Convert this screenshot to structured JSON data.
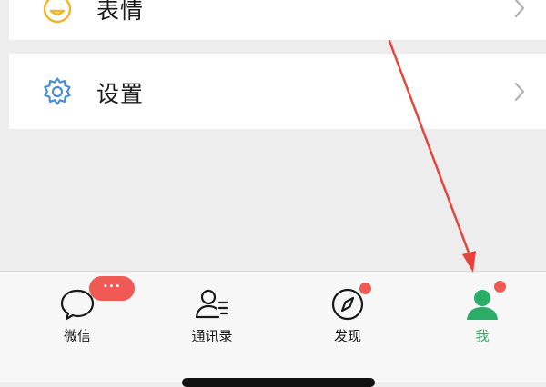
{
  "menu": {
    "items": [
      {
        "label": "表情",
        "icon": "emoji-icon"
      },
      {
        "label": "设置",
        "icon": "gear-icon"
      }
    ]
  },
  "tabbar": {
    "tabs": [
      {
        "label": "微信",
        "icon": "chat-bubble-icon",
        "badge": "···"
      },
      {
        "label": "通讯录",
        "icon": "contacts-icon"
      },
      {
        "label": "发现",
        "icon": "compass-icon",
        "badge_dot": true
      },
      {
        "label": "我",
        "icon": "person-icon",
        "badge_dot": true,
        "active": true
      }
    ]
  },
  "colors": {
    "accent_green": "#2aae67",
    "badge_red": "#f05a55",
    "icon_blue": "#4a8fd6",
    "annotation_arrow": "#e8433c"
  }
}
